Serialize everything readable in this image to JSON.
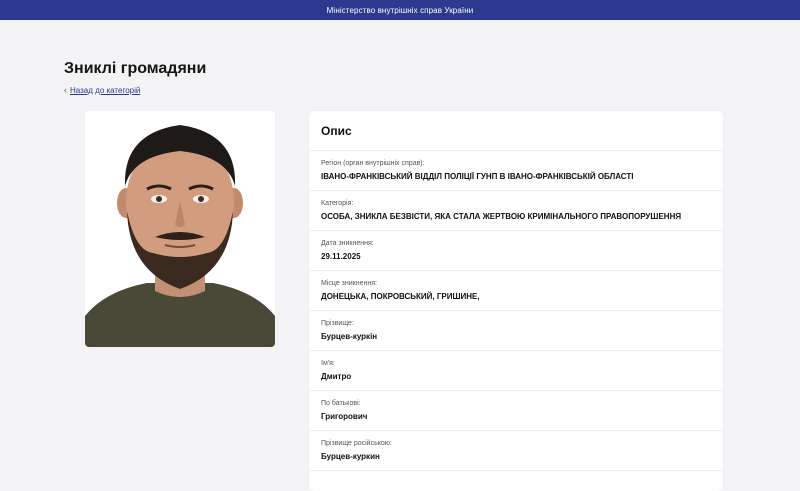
{
  "header": {
    "ministry": "Міністерство внутрішніх справ України"
  },
  "page": {
    "title": "Зниклі громадяни",
    "back_link": "Назад до категорій"
  },
  "photo": {
    "description_icon": "person-photo"
  },
  "card": {
    "title": "Опис",
    "fields": [
      {
        "label": "Регіон (орган внутрішніх справ):",
        "value": "ІВАНО-ФРАНКІВСЬКИЙ ВІДДІЛ ПОЛІЦІЇ ГУНП В ІВАНО-ФРАНКІВСЬКІЙ ОБЛАСТІ"
      },
      {
        "label": "Категорія:",
        "value": "ОСОБА, ЗНИКЛА БЕЗВІСТИ, ЯКА СТАЛА ЖЕРТВОЮ КРИМІНАЛЬНОГО ПРАВОПОРУШЕННЯ"
      },
      {
        "label": "Дата зникнення:",
        "value": "29.11.2025"
      },
      {
        "label": "Місце зникнення:",
        "value": "ДОНЕЦЬКА, ПОКРОВСЬКИЙ, ГРИШИНЕ,"
      },
      {
        "label": "Прізвище:",
        "value": "Бурцев-куркін"
      },
      {
        "label": "Ім'я:",
        "value": "Дмитро"
      },
      {
        "label": "По батькові:",
        "value": "Григорович"
      },
      {
        "label": "Прізвище російською:",
        "value": "Бурцев-куркин"
      }
    ]
  },
  "colors": {
    "topbar": "#2b3a8f",
    "background": "#f3f3f5",
    "link": "#2b3a8f"
  }
}
